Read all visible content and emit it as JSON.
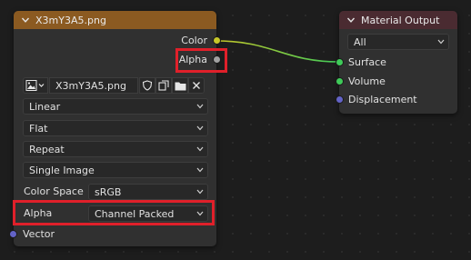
{
  "image_node": {
    "title": "X3mY3A5.png",
    "header_color": "#8b5a21",
    "outputs": {
      "color": "Color",
      "alpha": "Alpha"
    },
    "image_name": "X3mY3A5.png",
    "interpolation": "Linear",
    "projection": "Flat",
    "extension": "Repeat",
    "source": "Single Image",
    "color_space_label": "Color Space",
    "color_space_value": "sRGB",
    "alpha_label": "Alpha",
    "alpha_value": "Channel Packed",
    "input_vector": "Vector"
  },
  "output_node": {
    "title": "Material Output",
    "header_color": "#4a2b31",
    "target": "All",
    "inputs": {
      "surface": "Surface",
      "volume": "Volume",
      "displacement": "Displacement"
    }
  },
  "colors": {
    "color_socket": "#c7c729",
    "alpha_socket": "#a1a1a1",
    "shader_socket": "#3fca59",
    "vector_socket": "#6363c7",
    "highlight": "#e0202a"
  },
  "icons": {
    "collapse": "chevron-down-icon",
    "image_type": "image-icon",
    "fake_user": "shield-icon",
    "duplicate": "copy-icon",
    "open": "folder-icon",
    "unlink": "close-icon"
  }
}
